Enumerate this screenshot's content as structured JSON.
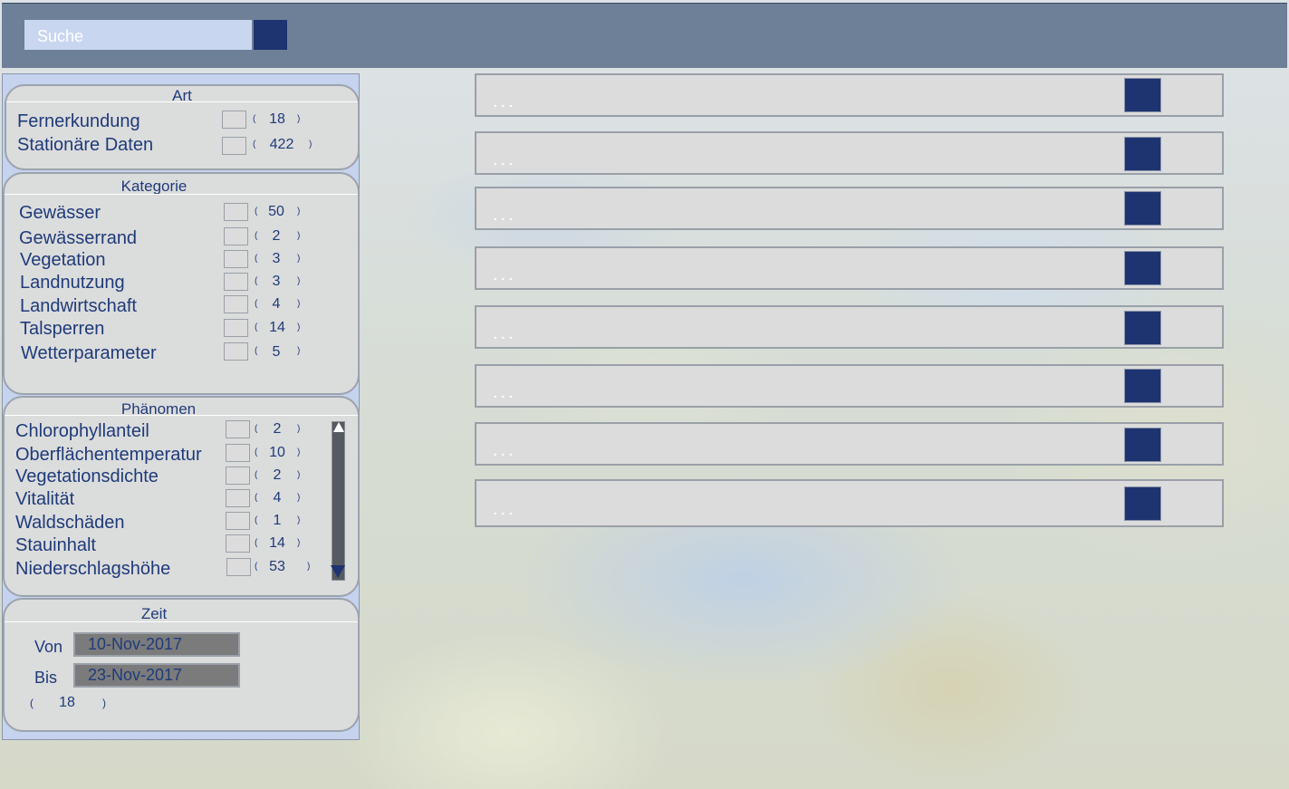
{
  "search": {
    "placeholder": "Suche"
  },
  "art": {
    "title": "Art",
    "items": [
      {
        "label": "Fernerkundung",
        "count": "18"
      },
      {
        "label": "Stationäre Daten",
        "count": "422"
      }
    ]
  },
  "kategorie": {
    "title": "Kategorie",
    "items": [
      {
        "label": "Gewässer",
        "count": "50"
      },
      {
        "label": "Gewässerrand",
        "count": "2"
      },
      {
        "label": "Vegetation",
        "count": "3"
      },
      {
        "label": "Landnutzung",
        "count": "3"
      },
      {
        "label": "Landwirtschaft",
        "count": "4"
      },
      {
        "label": "Talsperren",
        "count": "14"
      },
      {
        "label": "Wetterparameter",
        "count": "5"
      }
    ]
  },
  "phaenomen": {
    "title": "Phänomen",
    "items": [
      {
        "label": "Chlorophyllanteil",
        "count": "2"
      },
      {
        "label": "Oberflächentemperatur",
        "count": "10"
      },
      {
        "label": "Vegetationsdichte",
        "count": "2"
      },
      {
        "label": "Vitalität",
        "count": "4"
      },
      {
        "label": "Waldschäden",
        "count": "1"
      },
      {
        "label": "Stauinhalt",
        "count": "14"
      },
      {
        "label": "Niederschlagshöhe",
        "count": "53"
      }
    ]
  },
  "zeit": {
    "title": "Zeit",
    "von_label": "Von",
    "von_value": "10-Nov-2017",
    "bis_label": "Bis",
    "bis_value": "23-Nov-2017",
    "count": "18"
  },
  "results": [
    {
      "text": "..."
    },
    {
      "text": "..."
    },
    {
      "text": "..."
    },
    {
      "text": "..."
    },
    {
      "text": "..."
    },
    {
      "text": "..."
    },
    {
      "text": "..."
    },
    {
      "text": "..."
    }
  ],
  "colors": {
    "accent": "#1e3470",
    "topbar": "#6e8098",
    "label": "#1f3b7a",
    "panel": "#c5d3ee"
  }
}
